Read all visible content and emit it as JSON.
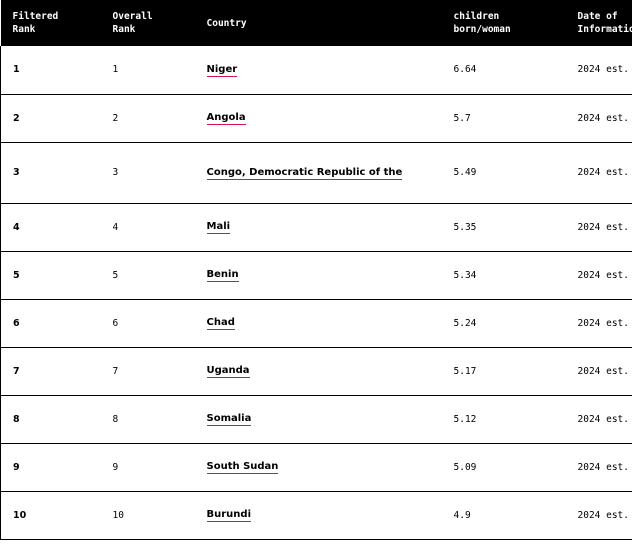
{
  "colors": {
    "header_bg": "#000000",
    "header_text": "#ffffff",
    "link_underline": "#d4145a",
    "row_divider": "#000000"
  },
  "table": {
    "headers": {
      "filtered_rank": "Filtered\nRank",
      "overall_rank": "Overall\nRank",
      "country": "Country",
      "value": "children\nborn/woman",
      "date": "Date of\nInformation"
    },
    "rows": [
      {
        "filtered_rank": "1",
        "overall_rank": "1",
        "country": "Niger",
        "value": "6.64",
        "date": "2024 est."
      },
      {
        "filtered_rank": "2",
        "overall_rank": "2",
        "country": "Angola",
        "value": "5.7",
        "date": "2024 est."
      },
      {
        "filtered_rank": "3",
        "overall_rank": "3",
        "country": "Congo, Democratic Republic of the",
        "value": "5.49",
        "date": "2024 est."
      },
      {
        "filtered_rank": "4",
        "overall_rank": "4",
        "country": "Mali",
        "value": "5.35",
        "date": "2024 est."
      },
      {
        "filtered_rank": "5",
        "overall_rank": "5",
        "country": "Benin",
        "value": "5.34",
        "date": "2024 est."
      },
      {
        "filtered_rank": "6",
        "overall_rank": "6",
        "country": "Chad",
        "value": "5.24",
        "date": "2024 est."
      },
      {
        "filtered_rank": "7",
        "overall_rank": "7",
        "country": "Uganda",
        "value": "5.17",
        "date": "2024 est."
      },
      {
        "filtered_rank": "8",
        "overall_rank": "8",
        "country": "Somalia",
        "value": "5.12",
        "date": "2024 est."
      },
      {
        "filtered_rank": "9",
        "overall_rank": "9",
        "country": "South Sudan",
        "value": "5.09",
        "date": "2024 est."
      },
      {
        "filtered_rank": "10",
        "overall_rank": "10",
        "country": "Burundi",
        "value": "4.9",
        "date": "2024 est."
      }
    ]
  }
}
